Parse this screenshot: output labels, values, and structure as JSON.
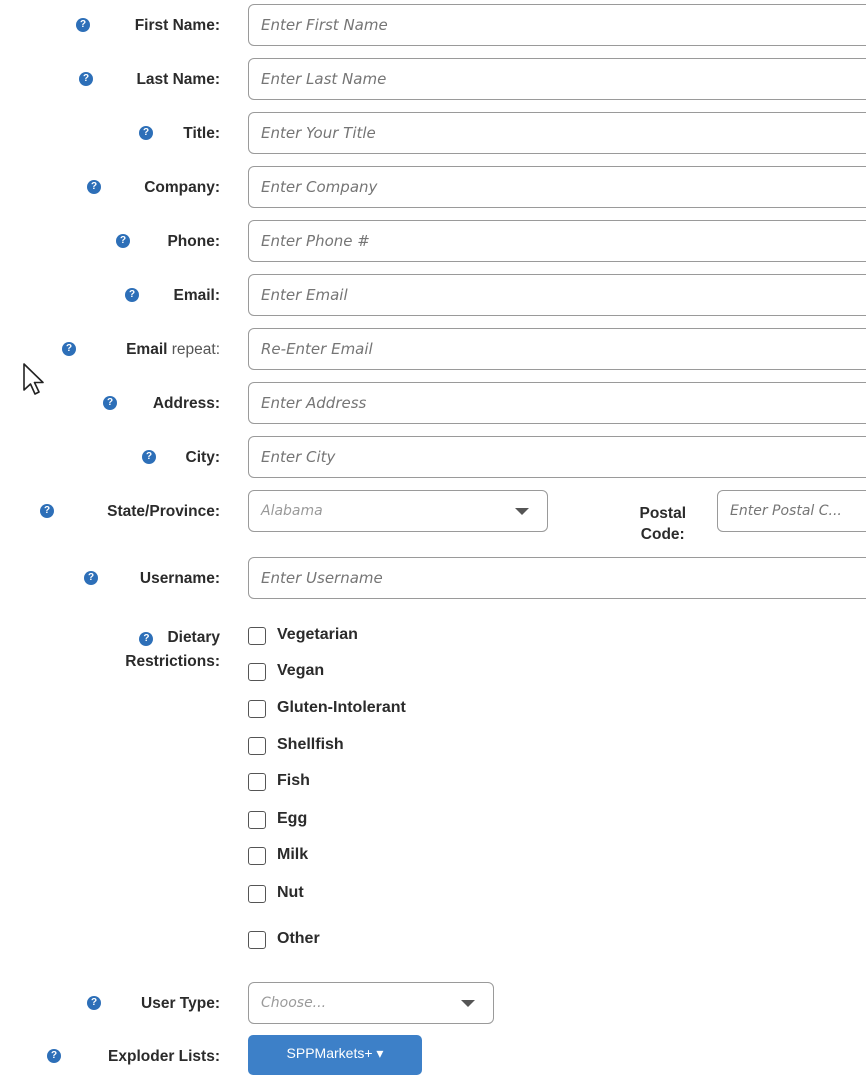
{
  "fields": [
    {
      "key": "first_name",
      "label": "First Name:",
      "placeholder": "Enter First Name"
    },
    {
      "key": "last_name",
      "label": "Last Name:",
      "placeholder": "Enter Last Name"
    },
    {
      "key": "title",
      "label": "Title:",
      "placeholder": "Enter Your Title"
    },
    {
      "key": "company",
      "label": "Company:",
      "placeholder": "Enter Company"
    },
    {
      "key": "phone",
      "label": "Phone:",
      "placeholder": "Enter Phone #"
    },
    {
      "key": "email",
      "label": "Email:",
      "placeholder": "Enter Email"
    },
    {
      "key": "email_repeat",
      "label_bold": "Email",
      "label_light": " repeat:",
      "placeholder": "Re-Enter Email"
    },
    {
      "key": "address",
      "label": "Address:",
      "placeholder": "Enter Address"
    },
    {
      "key": "city",
      "label": "City:",
      "placeholder": "Enter City"
    }
  ],
  "state": {
    "label": "State/Province:",
    "selected": "Alabama"
  },
  "postal": {
    "label_line1": "Postal",
    "label_line2": "Code:",
    "placeholder": "Enter Postal C..."
  },
  "username": {
    "label": "Username:",
    "placeholder": "Enter Username"
  },
  "dietary": {
    "label_line1": "Dietary",
    "label_line2": "Restrictions:",
    "options": [
      "Vegetarian",
      "Vegan",
      "Gluten-Intolerant",
      "Shellfish",
      "Fish",
      "Egg",
      "Milk",
      "Nut",
      "Other"
    ]
  },
  "user_type": {
    "label": "User Type:",
    "selected": "Choose..."
  },
  "exploder": {
    "label": "Exploder Lists:",
    "button": "SPPMarkets+ ▾"
  },
  "help_glyph": "?",
  "colors": {
    "accent": "#3d80c8",
    "help_icon": "#2d6fb8"
  }
}
